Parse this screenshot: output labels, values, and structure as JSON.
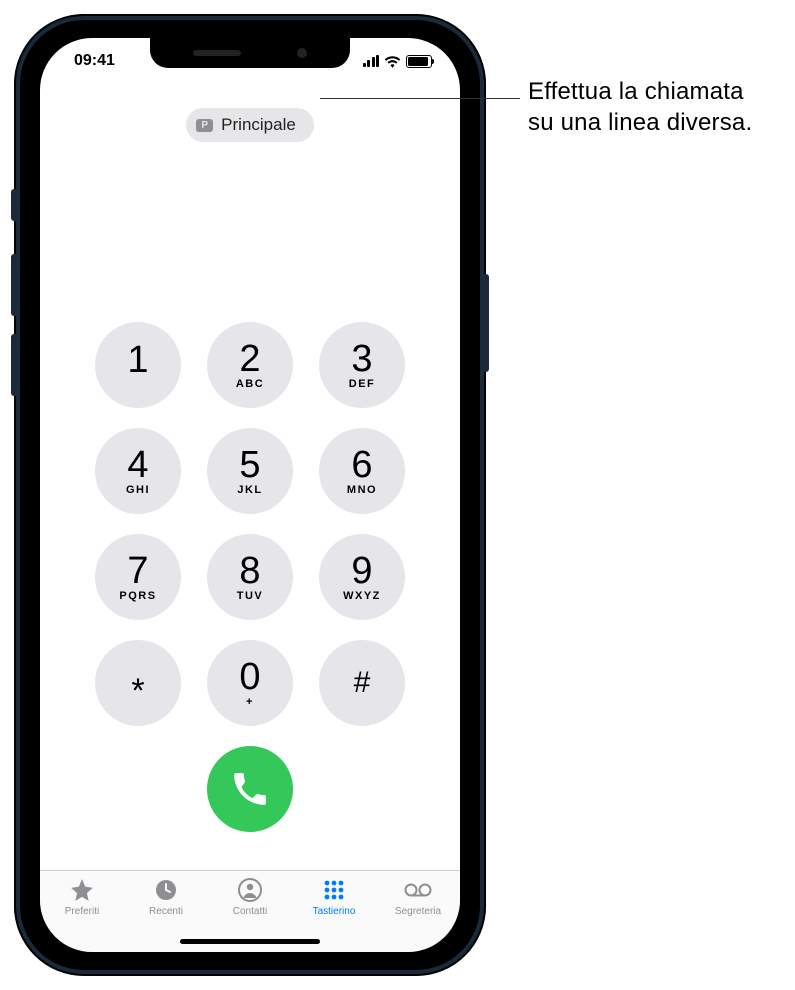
{
  "status": {
    "time": "09:41"
  },
  "line_selector": {
    "badge": "P",
    "label": "Principale"
  },
  "keypad": [
    {
      "digit": "1",
      "letters": ""
    },
    {
      "digit": "2",
      "letters": "ABC"
    },
    {
      "digit": "3",
      "letters": "DEF"
    },
    {
      "digit": "4",
      "letters": "GHI"
    },
    {
      "digit": "5",
      "letters": "JKL"
    },
    {
      "digit": "6",
      "letters": "MNO"
    },
    {
      "digit": "7",
      "letters": "PQRS"
    },
    {
      "digit": "8",
      "letters": "TUV"
    },
    {
      "digit": "9",
      "letters": "WXYZ"
    },
    {
      "digit": "*",
      "letters": ""
    },
    {
      "digit": "0",
      "letters": "+"
    },
    {
      "digit": "#",
      "letters": ""
    }
  ],
  "tabs": [
    {
      "label": "Preferiti"
    },
    {
      "label": "Recenti"
    },
    {
      "label": "Contatti"
    },
    {
      "label": "Tastierino"
    },
    {
      "label": "Segreteria"
    }
  ],
  "callout": {
    "line1": "Effettua la chiamata",
    "line2": "su una linea diversa."
  }
}
